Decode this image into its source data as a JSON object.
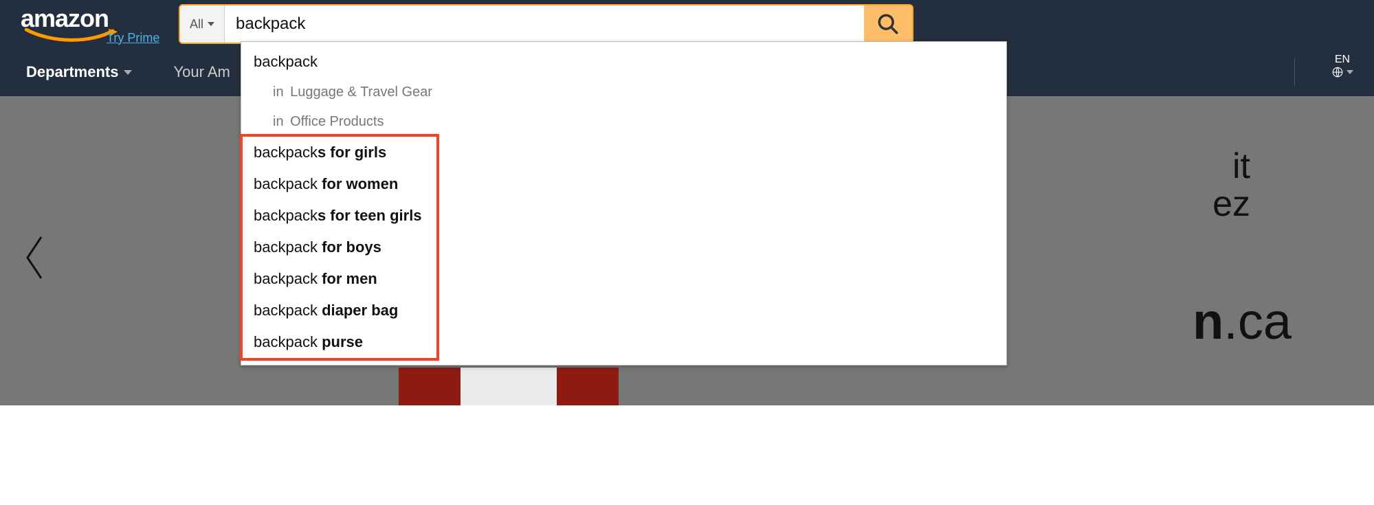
{
  "header": {
    "logo_text": "amazon",
    "prime_link": "Try Prime",
    "search": {
      "category_label": "All",
      "value": "backpack",
      "placeholder": ""
    }
  },
  "nav2": {
    "departments": "Departments",
    "your_amazon_partial": "Your Am"
  },
  "lang": {
    "code": "EN"
  },
  "autocomplete": {
    "top": "backpack",
    "sub_in": "in",
    "subcats": [
      "Luggage & Travel Gear",
      "Office Products"
    ],
    "suggestions": [
      {
        "prefix": "backpack",
        "suffix": "s for girls"
      },
      {
        "prefix": "backpack",
        "suffix": " for women"
      },
      {
        "prefix": "backpack",
        "suffix": "s for teen girls"
      },
      {
        "prefix": "backpack",
        "suffix": " for boys"
      },
      {
        "prefix": "backpack",
        "suffix": " for men"
      },
      {
        "prefix": "backpack",
        "suffix": " diaper bag"
      },
      {
        "prefix": "backpack",
        "suffix": " purse"
      }
    ]
  },
  "hero": {
    "line1_partial": "it",
    "line2_partial": "ez",
    "brand_frag": "n",
    "brand_domain": ".ca"
  }
}
